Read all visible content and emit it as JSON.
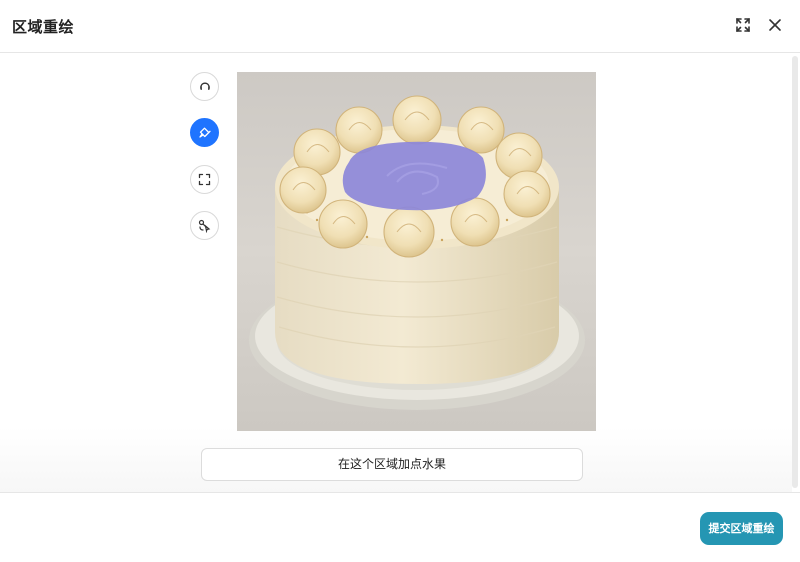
{
  "dialog": {
    "title": "区域重绘",
    "fullscreen_icon": "fullscreen-icon",
    "close_icon": "close-icon"
  },
  "tools": [
    {
      "name": "reset",
      "icon": "rotate-icon",
      "active": false
    },
    {
      "name": "brush",
      "icon": "brush-icon",
      "active": true
    },
    {
      "name": "select-area",
      "icon": "select-frame-icon",
      "active": false
    },
    {
      "name": "smart-select",
      "icon": "smart-select-icon",
      "active": false
    }
  ],
  "prompt": {
    "value": "在这个区域加点水果"
  },
  "footer": {
    "submit_label": "提交区域重绘"
  },
  "colors": {
    "accent": "#1f74ff",
    "submit": "#2596b3",
    "mask": "#8c87d9"
  }
}
